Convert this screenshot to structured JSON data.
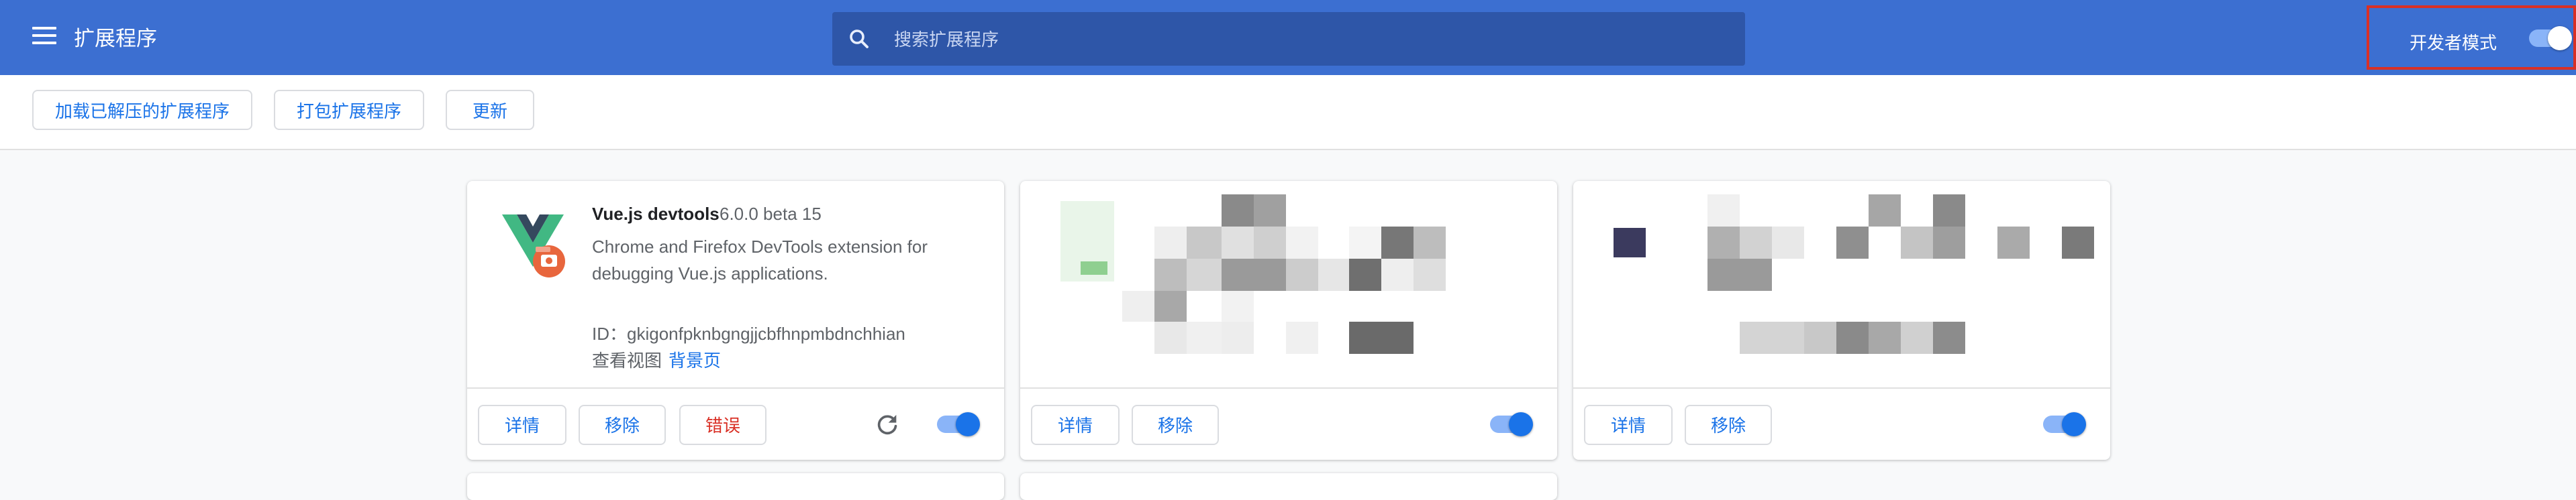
{
  "header": {
    "title": "扩展程序",
    "search_placeholder": "搜索扩展程序",
    "dev_mode_label": "开发者模式",
    "dev_mode_enabled": true
  },
  "toolbar": {
    "load_unpacked": "加载已解压的扩展程序",
    "pack_extension": "打包扩展程序",
    "update": "更新"
  },
  "cards": [
    {
      "name": "Vue.js devtools",
      "version": "6.0.0 beta 15",
      "description": "Chrome and Firefox DevTools extension for debugging Vue.js applications.",
      "id_text": "ID：gkigonfpknbgngjjcbfhnpmbdnchhian",
      "views_label": "查看视图",
      "views_link": "背景页",
      "details": "详情",
      "remove": "移除",
      "errors": "错误",
      "enabled": true
    },
    {
      "details": "详情",
      "remove": "移除",
      "enabled": true
    },
    {
      "details": "详情",
      "remove": "移除",
      "enabled": true
    }
  ],
  "colors": {
    "header_bg": "#3c6fd1",
    "search_bg": "#2e56a8",
    "accent": "#1a73e8",
    "error": "#d93025"
  }
}
